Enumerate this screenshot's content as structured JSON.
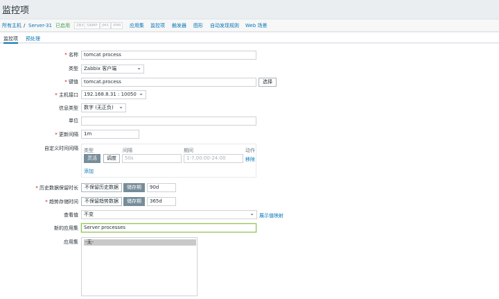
{
  "page_title": "监控项",
  "breadcrumb": {
    "all_hosts": "所有主机",
    "separator": "/",
    "host": "Server-31",
    "status": "已启用",
    "badges": [
      "ZBX",
      "SNMP",
      "JMX",
      "IPMI"
    ]
  },
  "host_nav": [
    "应用集",
    "监控项",
    "触发器",
    "图形",
    "自动发现规则",
    "Web 场景"
  ],
  "tabs": [
    "监控项",
    "预处理"
  ],
  "form": {
    "name_label": "名称",
    "name_value": "tomcat process",
    "type_label": "类型",
    "type_value": "Zabbix 客户端",
    "key_label": "键值",
    "key_value": "tomcat.process",
    "key_select_button": "选择",
    "interface_label": "主机接口",
    "interface_value": "192.168.8.31 : 10050",
    "info_type_label": "信息类型",
    "info_type_value": "数字 (无正负)",
    "units_label": "单位",
    "units_value": "",
    "interval_label": "更新间隔",
    "interval_value": "1m",
    "custom_intervals_label": "自定义时间间隔",
    "custom_intervals": {
      "col_type": "类型",
      "col_interval": "间隔",
      "col_period": "期间",
      "col_action": "动作",
      "opt_flexible": "灵活",
      "opt_scheduling": "调度",
      "interval_placeholder": "50s",
      "period_placeholder": "1-7,00:00-24:00",
      "remove": "移除",
      "add": "添加"
    },
    "history_label": "历史数据保留时长",
    "history_no_keep": "不保留历史数据",
    "history_keep": "储存期",
    "history_value": "90d",
    "trends_label": "趋势存储时间",
    "trends_no_keep": "不保留趋势数据",
    "trends_keep": "储存期",
    "trends_value": "365d",
    "show_value_label": "查看值",
    "show_value_value": "不变",
    "show_value_link": "展示值映射",
    "new_app_label": "新的应用集",
    "new_app_value": "Server processes",
    "apps_label": "应用集",
    "apps_option": "-无-"
  }
}
